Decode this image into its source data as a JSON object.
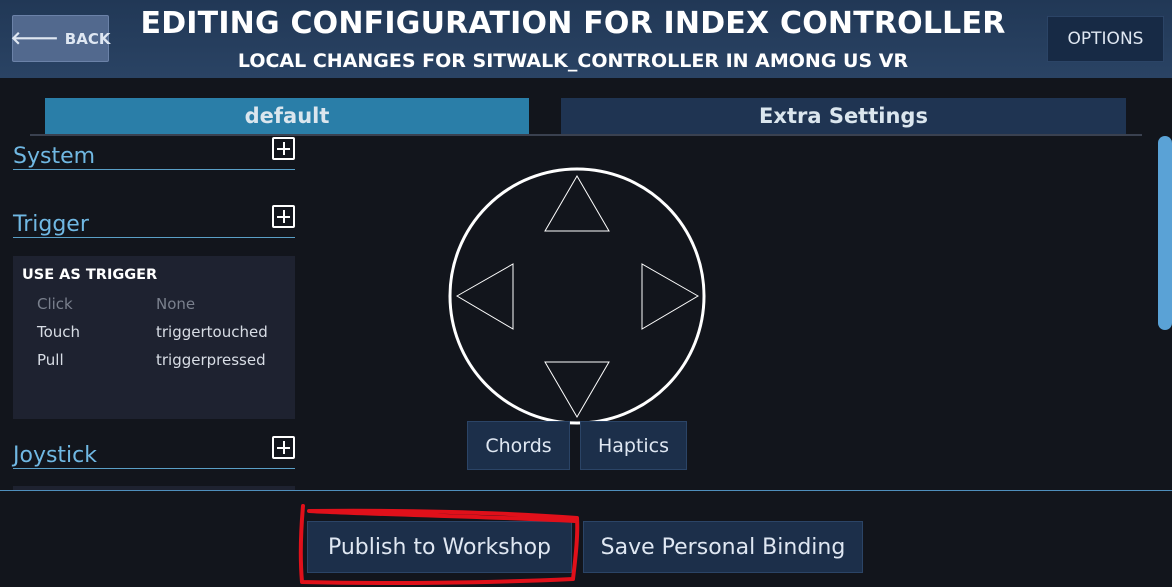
{
  "header": {
    "back_label": "BACK",
    "title": "EDITING CONFIGURATION FOR INDEX CONTROLLER",
    "subtitle": "LOCAL CHANGES FOR SITWALK_CONTROLLER IN AMONG US VR",
    "options_label": "OPTIONS"
  },
  "tabs": [
    {
      "label": "default",
      "active": true
    },
    {
      "label": "Extra Settings",
      "active": false
    }
  ],
  "sections": {
    "system": {
      "label": "System"
    },
    "trigger": {
      "label": "Trigger",
      "card": {
        "title": "USE AS TRIGGER",
        "rows": [
          {
            "input": "Click",
            "action": "None"
          },
          {
            "input": "Touch",
            "action": "triggertouched"
          },
          {
            "input": "Pull",
            "action": "triggerpressed"
          }
        ]
      }
    },
    "joystick": {
      "label": "Joystick"
    }
  },
  "center": {
    "chords_label": "Chords",
    "haptics_label": "Haptics"
  },
  "footer": {
    "publish_label": "Publish to Workshop",
    "save_label": "Save Personal Binding"
  },
  "colors": {
    "header_bg": "#2a4364",
    "active_tab": "#2a7ea8",
    "inactive_tab": "#1f3452",
    "section_label": "#70b8e3",
    "annotation": "#e0101a"
  },
  "icons": [
    "back-arrow-icon",
    "plus-icon",
    "dpad-up-icon",
    "dpad-down-icon",
    "dpad-left-icon",
    "dpad-right-icon"
  ]
}
